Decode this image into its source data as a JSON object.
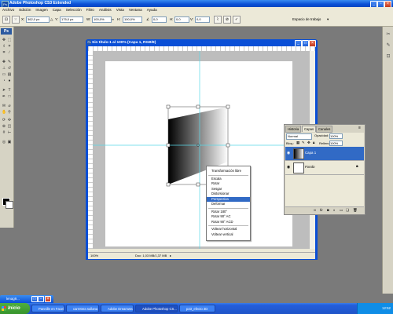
{
  "app": {
    "title": "Adobe Photoshop CS3 Extended"
  },
  "menu": [
    "Archivo",
    "Edición",
    "Imagen",
    "Capa",
    "Selección",
    "Filtro",
    "Análisis",
    "Vista",
    "Ventana",
    "Ayuda"
  ],
  "options_bar": {
    "x_label": "X:",
    "x_value": "362,0 px",
    "y_label": "Y:",
    "y_value": "175,0 px",
    "w_label": "W:",
    "w_value": "100,0%",
    "h_label": "H:",
    "h_value": "100,0%",
    "angle_value": "0,0",
    "h_skew_label": "H:",
    "h_skew_value": "0,0",
    "v_label": "V:",
    "v_value": "0,0",
    "workspace_label": "Espacio de trabajo"
  },
  "document": {
    "title": "Sin título-1 al 100% (Capa 1, RGB/8)",
    "zoom": "100%",
    "doc_info": "Doc: 1,03 MB/1,37 MB"
  },
  "layers_panel": {
    "tabs": [
      "Historia",
      "Capas",
      "Canales"
    ],
    "blend_mode": "Normal",
    "opacity_label": "Opacidad:",
    "opacity": "100%",
    "lock_label": "Bloq.:",
    "fill_label": "Relleno:",
    "fill": "100%",
    "layers": [
      {
        "name": "Capa 1"
      },
      {
        "name": "Fondo"
      }
    ],
    "footer_icons": [
      "link-icon",
      "fx-icon",
      "mask-icon",
      "adjustment-icon",
      "folder-icon",
      "new-layer-icon",
      "trash-icon"
    ]
  },
  "context_menu": {
    "items": [
      {
        "label": "Transformación libre"
      },
      {
        "sep": true
      },
      {
        "label": "Escala"
      },
      {
        "label": "Rotar"
      },
      {
        "label": "Sesgar"
      },
      {
        "label": "Distorsionar"
      },
      {
        "label": "Perspectiva",
        "highlighted": true
      },
      {
        "label": "Deformar"
      },
      {
        "sep": true
      },
      {
        "label": "Rotar 180°"
      },
      {
        "label": "Rotar 90° AC"
      },
      {
        "label": "Rotar 90° ACD"
      },
      {
        "sep": true
      },
      {
        "label": "Voltear horizontal"
      },
      {
        "label": "Voltear vertical"
      }
    ]
  },
  "minimized_window": {
    "label": "lenag9..."
  },
  "taskbar": {
    "start": "Inicio",
    "items": [
      {
        "label": "Pannille en Facebo..."
      },
      {
        "label": "carretera sullana co..."
      },
      {
        "label": "Adobe Dreamweaver ..."
      },
      {
        "label": "Adobe Photoshop CS...",
        "active": true
      },
      {
        "label": "p23_efecto 3D"
      }
    ],
    "clock": "12:52"
  },
  "colors": {
    "title_blue": "#0a4fd6",
    "menu_bg": "#ece9d8",
    "highlight": "#316ac5",
    "start_green": "#37942c"
  }
}
